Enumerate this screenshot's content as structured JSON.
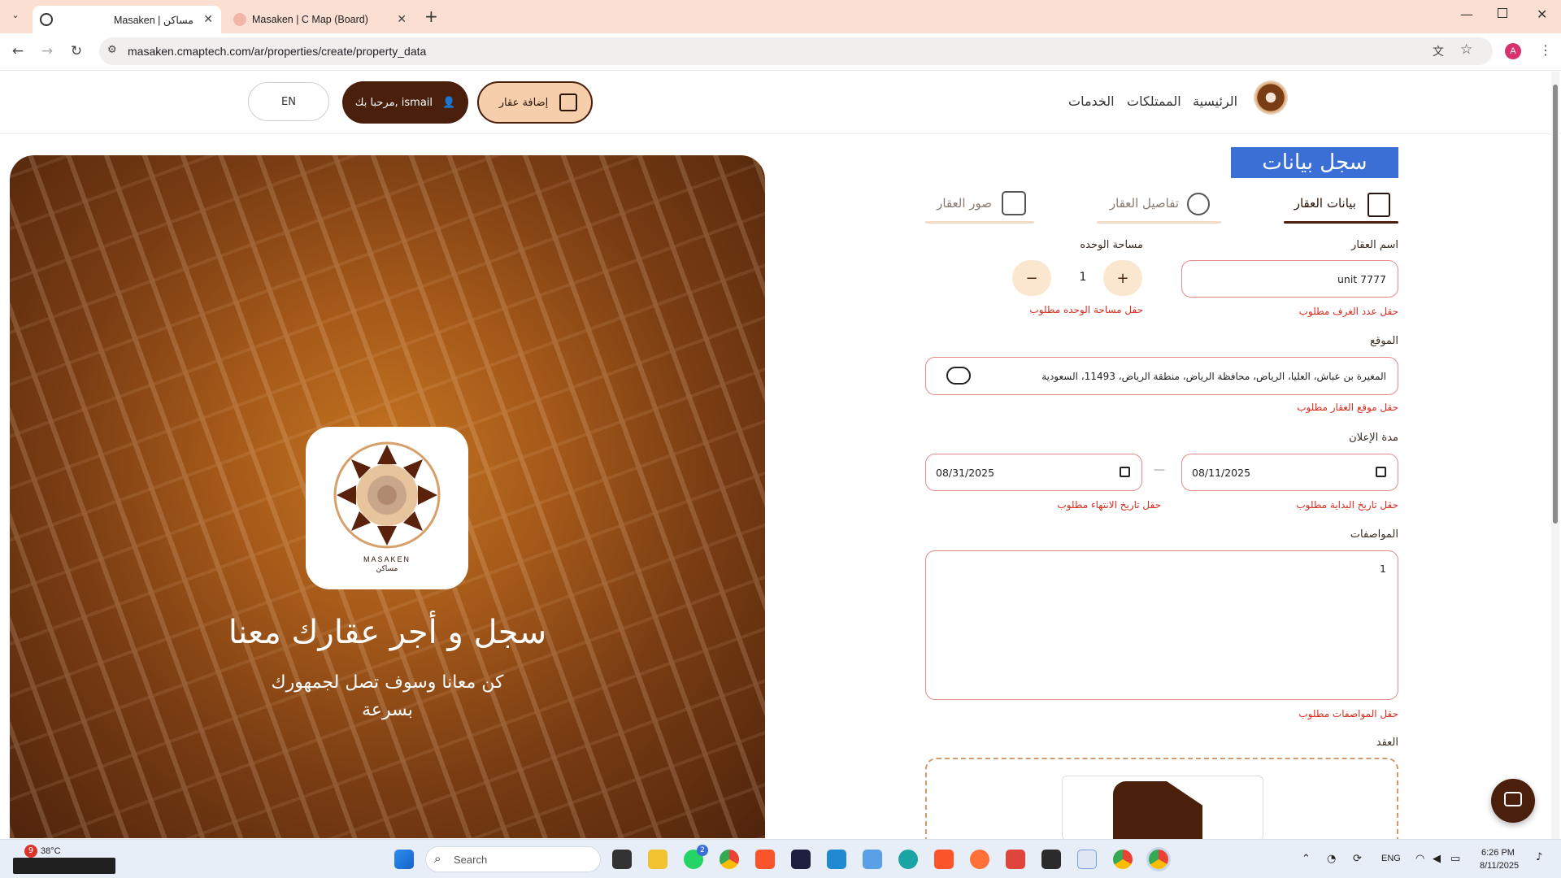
{
  "browser": {
    "tabs": [
      {
        "title": "Masaken | مساكن"
      },
      {
        "title": "Masaken | C Map (Board)"
      }
    ],
    "url": "masaken.cmaptech.com/ar/properties/create/property_data",
    "profile_initial": "A"
  },
  "site": {
    "nav": [
      "الرئيسية",
      "الممتلكات",
      "الخدمات"
    ],
    "add_property_label": "إضافة عقار",
    "welcome_label": "مرحبا بك, ismail",
    "lang_label": "EN",
    "logo_text": "MASAKEN"
  },
  "promo": {
    "title": "سجل و أجر عقارك معنا",
    "subtitle_line1": "كن معانا وسوف تصل لجمهورك",
    "subtitle_line2": "بسرعة",
    "logo_latin": "MASAKEN",
    "logo_arabic": "مساكن"
  },
  "form": {
    "page_title": "سجل بيانات عقارك",
    "tabs": [
      {
        "label": "بيانات العقار",
        "active": true
      },
      {
        "label": "تفاصيل العقار",
        "active": false
      },
      {
        "label": "صور العقار",
        "active": false
      }
    ],
    "property_name": {
      "label": "اسم العقار",
      "value": "unit 7777",
      "error": "حقل عدد الغرف مطلوب"
    },
    "unit_area": {
      "label": "مساحة الوحده",
      "value": "1",
      "plus": "+",
      "minus": "−",
      "error": "حقل مساحة الوحده مطلوب"
    },
    "location": {
      "label": "الموقع",
      "value": "المغيرة بن عباش، العليا، الرياض، محافظة الرياض، منطقة الرياض، 11493، السعودية",
      "error": "حقل موقع العقار مطلوب"
    },
    "ad_period": {
      "label": "مدة الإعلان",
      "start": "08/11/2025",
      "start_error": "حقل تاريخ البداية مطلوب",
      "end": "08/31/2025",
      "end_error": "حقل تاريخ الانتهاء مطلوب",
      "separator": "—"
    },
    "specs": {
      "label": "المواصفات",
      "value": "1",
      "error": "حقل المواصفات مطلوب"
    },
    "contract": {
      "label": "العقد"
    }
  },
  "taskbar": {
    "weather_temp": "38°C",
    "weather_badge": "9",
    "search_placeholder": "Search",
    "lang": "ENG",
    "time": "6:26 PM",
    "date": "8/11/2025",
    "whatsapp_badge": "2"
  },
  "colors": {
    "brand_dark": "#4a1f0c",
    "brand_light": "#fbe6cf",
    "error": "#d92d20",
    "tab_bar": "#fbdfd2"
  }
}
